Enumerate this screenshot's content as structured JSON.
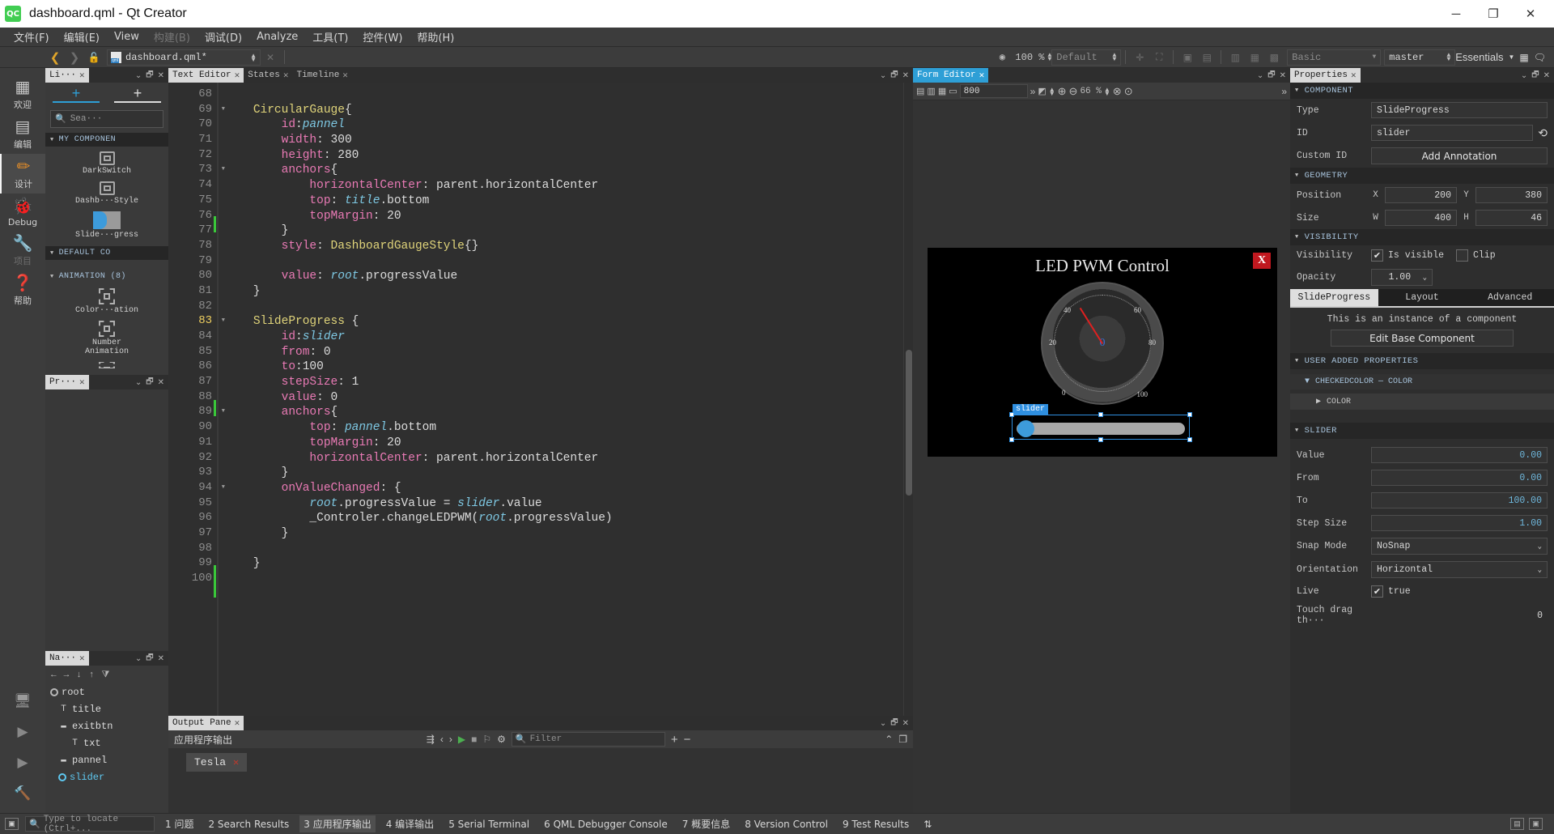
{
  "window": {
    "title": "dashboard.qml - Qt Creator",
    "logo": "qt-creator-logo",
    "minimize": "─",
    "maximize": "❐",
    "close": "✕"
  },
  "menu": [
    {
      "label": "文件(F)",
      "disabled": false
    },
    {
      "label": "编辑(E)",
      "disabled": false
    },
    {
      "label": "View",
      "disabled": false
    },
    {
      "label": "构建(B)",
      "disabled": true
    },
    {
      "label": "调试(D)",
      "disabled": false
    },
    {
      "label": "Analyze",
      "disabled": false
    },
    {
      "label": "工具(T)",
      "disabled": false
    },
    {
      "label": "控件(W)",
      "disabled": false
    },
    {
      "label": "帮助(H)",
      "disabled": false
    }
  ],
  "toolbar": {
    "back_icon": "❮",
    "forward_icon": "❯",
    "lock_icon": "🔓",
    "file_name": "dashboard.qml*",
    "file_icon": "qml-file-icon",
    "close_file_icon": "✕",
    "zoom_icon": "◉",
    "zoom_value": "100 %",
    "style_combo": "Default",
    "theme_combo": "Basic",
    "branch_combo": "master",
    "essentials_label": "Essentials"
  },
  "modes": [
    {
      "label": "欢迎",
      "icon": "grid-icon",
      "selected": false,
      "disabled": false
    },
    {
      "label": "编辑",
      "icon": "document-icon",
      "selected": false,
      "disabled": false
    },
    {
      "label": "设计",
      "icon": "pencil-icon",
      "selected": true,
      "disabled": false
    },
    {
      "label": "Debug",
      "icon": "bug-icon",
      "selected": false,
      "disabled": false
    },
    {
      "label": "项目",
      "icon": "wrench-icon",
      "selected": false,
      "disabled": true
    },
    {
      "label": "帮助",
      "icon": "question-icon",
      "selected": false,
      "disabled": false
    }
  ],
  "library": {
    "tab_label": "Li···",
    "tab_close": "✕",
    "add_component_icon": "+",
    "add_asset_icon": "+",
    "search_placeholder": "Sea···",
    "search_icon": "search-icon",
    "sections": [
      {
        "title": "MY COMPONEN",
        "items": [
          {
            "label": "DarkSwitch",
            "icon": "chip-icon"
          },
          {
            "label": "Dashb···Style",
            "icon": "chip-icon"
          },
          {
            "label": "Slide···gress",
            "icon": "slider-icon"
          }
        ]
      },
      {
        "title": "DEFAULT CO",
        "items": []
      },
      {
        "title": "ANIMATION (8)",
        "items": [
          {
            "label": "Color···ation",
            "icon": "animation-icon"
          },
          {
            "label": "Number\nAnimation",
            "icon": "animation-icon"
          }
        ]
      }
    ]
  },
  "properties_dock": {
    "tab_label": "Pr···",
    "tab_close": "✕"
  },
  "navigator": {
    "tab_label": "Na···",
    "tab_close": "✕",
    "toolbar_icons": [
      "←",
      "→",
      "↓",
      "↑",
      "filter-icon"
    ],
    "tree": [
      {
        "label": "root",
        "icon": "⬡",
        "indent": 0,
        "selected": false
      },
      {
        "label": "title",
        "icon": "T",
        "indent": 1,
        "selected": false
      },
      {
        "label": "exitbtn",
        "icon": "▭",
        "indent": 1,
        "selected": false
      },
      {
        "label": "txt",
        "icon": "T",
        "indent": 2,
        "selected": false
      },
      {
        "label": "pannel",
        "icon": "▭",
        "indent": 1,
        "selected": false
      },
      {
        "label": "slider",
        "icon": "⬡",
        "indent": 1,
        "selected": true
      }
    ]
  },
  "editor": {
    "tabs": [
      {
        "label": "Text Editor",
        "active": true
      },
      {
        "label": "States",
        "active": false
      },
      {
        "label": "Timeline",
        "active": false
      }
    ],
    "first_line": 68,
    "current_line": 83,
    "lines": [
      {
        "n": 68,
        "fold": false,
        "tokens": []
      },
      {
        "n": 69,
        "fold": true,
        "tokens": [
          {
            "t": "    ",
            "c": "p"
          },
          {
            "t": "CircularGauge",
            "c": "type"
          },
          {
            "t": "{",
            "c": "p"
          }
        ]
      },
      {
        "n": 70,
        "fold": false,
        "tokens": [
          {
            "t": "        ",
            "c": "p"
          },
          {
            "t": "id",
            "c": "prop"
          },
          {
            "t": ":",
            "c": "p"
          },
          {
            "t": "pannel",
            "c": "id"
          }
        ]
      },
      {
        "n": 71,
        "fold": false,
        "tokens": [
          {
            "t": "        ",
            "c": "p"
          },
          {
            "t": "width",
            "c": "prop"
          },
          {
            "t": ": 300",
            "c": "p"
          }
        ]
      },
      {
        "n": 72,
        "fold": false,
        "tokens": [
          {
            "t": "        ",
            "c": "p"
          },
          {
            "t": "height",
            "c": "prop"
          },
          {
            "t": ": 280",
            "c": "p"
          }
        ]
      },
      {
        "n": 73,
        "fold": true,
        "tokens": [
          {
            "t": "        ",
            "c": "p"
          },
          {
            "t": "anchors",
            "c": "prop"
          },
          {
            "t": "{",
            "c": "p"
          }
        ]
      },
      {
        "n": 74,
        "fold": false,
        "tokens": [
          {
            "t": "            ",
            "c": "p"
          },
          {
            "t": "horizontalCenter",
            "c": "prop"
          },
          {
            "t": ": parent.horizontalCenter",
            "c": "p"
          }
        ]
      },
      {
        "n": 75,
        "fold": false,
        "tokens": [
          {
            "t": "            ",
            "c": "p"
          },
          {
            "t": "top",
            "c": "prop"
          },
          {
            "t": ": ",
            "c": "p"
          },
          {
            "t": "title",
            "c": "id"
          },
          {
            "t": ".bottom",
            "c": "p"
          }
        ]
      },
      {
        "n": 76,
        "fold": false,
        "tokens": [
          {
            "t": "            ",
            "c": "p"
          },
          {
            "t": "topMargin",
            "c": "prop"
          },
          {
            "t": ": 20",
            "c": "p"
          }
        ]
      },
      {
        "n": 77,
        "fold": false,
        "tokens": [
          {
            "t": "        }",
            "c": "p"
          }
        ]
      },
      {
        "n": 78,
        "fold": false,
        "tokens": [
          {
            "t": "        ",
            "c": "p"
          },
          {
            "t": "style",
            "c": "prop"
          },
          {
            "t": ": ",
            "c": "p"
          },
          {
            "t": "DashboardGaugeStyle",
            "c": "type"
          },
          {
            "t": "{}",
            "c": "p"
          }
        ]
      },
      {
        "n": 79,
        "fold": false,
        "tokens": []
      },
      {
        "n": 80,
        "fold": false,
        "tokens": [
          {
            "t": "        ",
            "c": "p"
          },
          {
            "t": "value",
            "c": "prop"
          },
          {
            "t": ": ",
            "c": "p"
          },
          {
            "t": "root",
            "c": "id"
          },
          {
            "t": ".progressValue",
            "c": "p"
          }
        ]
      },
      {
        "n": 81,
        "fold": false,
        "tokens": [
          {
            "t": "    }",
            "c": "p"
          }
        ]
      },
      {
        "n": 82,
        "fold": false,
        "tokens": []
      },
      {
        "n": 83,
        "fold": true,
        "tokens": [
          {
            "t": "    ",
            "c": "p"
          },
          {
            "t": "SlideProgress",
            "c": "type"
          },
          {
            "t": " {",
            "c": "p"
          }
        ]
      },
      {
        "n": 84,
        "fold": false,
        "tokens": [
          {
            "t": "        ",
            "c": "p"
          },
          {
            "t": "id",
            "c": "prop"
          },
          {
            "t": ":",
            "c": "p"
          },
          {
            "t": "slider",
            "c": "id"
          }
        ]
      },
      {
        "n": 85,
        "fold": false,
        "tokens": [
          {
            "t": "        ",
            "c": "p"
          },
          {
            "t": "from",
            "c": "prop"
          },
          {
            "t": ": 0",
            "c": "p"
          }
        ]
      },
      {
        "n": 86,
        "fold": false,
        "tokens": [
          {
            "t": "        ",
            "c": "p"
          },
          {
            "t": "to",
            "c": "prop"
          },
          {
            "t": ":100",
            "c": "p"
          }
        ]
      },
      {
        "n": 87,
        "fold": false,
        "tokens": [
          {
            "t": "        ",
            "c": "p"
          },
          {
            "t": "stepSize",
            "c": "prop"
          },
          {
            "t": ": 1",
            "c": "p"
          }
        ]
      },
      {
        "n": 88,
        "fold": false,
        "tokens": [
          {
            "t": "        ",
            "c": "p"
          },
          {
            "t": "value",
            "c": "prop"
          },
          {
            "t": ": 0",
            "c": "p"
          }
        ]
      },
      {
        "n": 89,
        "fold": true,
        "tokens": [
          {
            "t": "        ",
            "c": "p"
          },
          {
            "t": "anchors",
            "c": "prop"
          },
          {
            "t": "{",
            "c": "p"
          }
        ]
      },
      {
        "n": 90,
        "fold": false,
        "tokens": [
          {
            "t": "            ",
            "c": "p"
          },
          {
            "t": "top",
            "c": "prop"
          },
          {
            "t": ": ",
            "c": "p"
          },
          {
            "t": "pannel",
            "c": "id"
          },
          {
            "t": ".bottom",
            "c": "p"
          }
        ]
      },
      {
        "n": 91,
        "fold": false,
        "tokens": [
          {
            "t": "            ",
            "c": "p"
          },
          {
            "t": "topMargin",
            "c": "prop"
          },
          {
            "t": ": 20",
            "c": "p"
          }
        ]
      },
      {
        "n": 92,
        "fold": false,
        "tokens": [
          {
            "t": "            ",
            "c": "p"
          },
          {
            "t": "horizontalCenter",
            "c": "prop"
          },
          {
            "t": ": parent.horizontalCenter",
            "c": "p"
          }
        ]
      },
      {
        "n": 93,
        "fold": false,
        "tokens": [
          {
            "t": "        }",
            "c": "p"
          }
        ]
      },
      {
        "n": 94,
        "fold": true,
        "tokens": [
          {
            "t": "        ",
            "c": "p"
          },
          {
            "t": "onValueChanged",
            "c": "prop"
          },
          {
            "t": ": {",
            "c": "p"
          }
        ]
      },
      {
        "n": 95,
        "fold": false,
        "tokens": [
          {
            "t": "            ",
            "c": "p"
          },
          {
            "t": "root",
            "c": "id"
          },
          {
            "t": ".progressValue = ",
            "c": "p"
          },
          {
            "t": "slider",
            "c": "id"
          },
          {
            "t": ".value",
            "c": "p"
          }
        ]
      },
      {
        "n": 96,
        "fold": false,
        "tokens": [
          {
            "t": "            _Controler.changeLEDPWM(",
            "c": "p"
          },
          {
            "t": "root",
            "c": "id"
          },
          {
            "t": ".progressValue)",
            "c": "p"
          }
        ]
      },
      {
        "n": 97,
        "fold": false,
        "tokens": [
          {
            "t": "        }",
            "c": "p"
          }
        ]
      },
      {
        "n": 98,
        "fold": false,
        "tokens": []
      },
      {
        "n": 99,
        "fold": false,
        "tokens": [
          {
            "t": "    }",
            "c": "p"
          }
        ]
      },
      {
        "n": 100,
        "fold": false,
        "tokens": []
      }
    ]
  },
  "form_editor": {
    "tab_label": "Form Editor",
    "tab_close": "✕",
    "width_value": "800",
    "zoom_value": "66 %",
    "zoom_in_icon": "⊕",
    "zoom_out_icon": "⊖",
    "device": {
      "title": "LED PWM Control",
      "exit_label": "X",
      "gauge": {
        "ticks": [
          "20",
          "40",
          "60",
          "80",
          "100",
          "0"
        ],
        "center_value": "0"
      },
      "selection_label": "slider"
    }
  },
  "properties": {
    "tab_label": "Properties",
    "tab_close": "✕",
    "sections": {
      "component": {
        "title": "COMPONENT",
        "type_label": "Type",
        "type_value": "SlideProgress",
        "id_label": "ID",
        "id_value": "slider",
        "reset_icon": "reset-icon",
        "custom_id_label": "Custom ID",
        "annotation_button": "Add Annotation"
      },
      "geometry": {
        "title": "GEOMETRY",
        "position_label": "Position",
        "x_label": "X",
        "x_value": "200",
        "y_label": "Y",
        "y_value": "380",
        "size_label": "Size",
        "w_label": "W",
        "w_value": "400",
        "h_label": "H",
        "h_value": "46"
      },
      "visibility": {
        "title": "VISIBILITY",
        "visibility_label": "Visibility",
        "is_visible_label": "Is visible",
        "is_visible_checked": "✔",
        "clip_label": "Clip",
        "clip_checked": "",
        "opacity_label": "Opacity",
        "opacity_value": "1.00"
      },
      "tabs": [
        {
          "label": "SlideProgress",
          "selected": true
        },
        {
          "label": "Layout",
          "selected": false
        },
        {
          "label": "Advanced",
          "selected": false
        }
      ],
      "instance_note": "This is an instance of a component",
      "edit_base_button": "Edit Base Component",
      "user_added": {
        "title": "USER ADDED PROPERTIES",
        "checkedcolor": "CHECKEDCOLOR — COLOR",
        "color": "COLOR"
      },
      "slider": {
        "title": "SLIDER",
        "rows": [
          {
            "label": "Value",
            "value": "0.00",
            "type": "num"
          },
          {
            "label": "From",
            "value": "0.00",
            "type": "num"
          },
          {
            "label": "To",
            "value": "100.00",
            "type": "num"
          },
          {
            "label": "Step Size",
            "value": "1.00",
            "type": "num"
          },
          {
            "label": "Snap Mode",
            "value": "NoSnap",
            "type": "combo"
          },
          {
            "label": "Orientation",
            "value": "Horizontal",
            "type": "combo"
          },
          {
            "label": "Live",
            "value": "true",
            "type": "check"
          },
          {
            "label": "Touch drag th···",
            "value": "0",
            "type": "num-plain"
          }
        ]
      }
    }
  },
  "output_pane": {
    "tab_label": "Output Pane",
    "tab_close": "✕",
    "title": "应用程序输出",
    "filter_placeholder": "Filter",
    "search_icon": "search-icon",
    "run_tab": "Tesla",
    "run_tab_close": "✕",
    "buttons": [
      "word-wrap-icon",
      "‹",
      "›",
      "▶",
      "■",
      "⚑",
      "⚙"
    ],
    "zoom_plus": "+",
    "zoom_minus": "−",
    "minimize_icon": "⌃",
    "maximize_icon": "❐"
  },
  "statusbar": {
    "locate_placeholder": "Type to locate (Ctrl+...",
    "locate_icon": "search-icon",
    "toggle_icon": "▣",
    "items": [
      {
        "label": "1 问题",
        "selected": false
      },
      {
        "label": "2 Search Results",
        "selected": false
      },
      {
        "label": "3 应用程序输出",
        "selected": true
      },
      {
        "label": "4 编译输出",
        "selected": false
      },
      {
        "label": "5 Serial Terminal",
        "selected": false
      },
      {
        "label": "6 QML Debugger Console",
        "selected": false
      },
      {
        "label": "7 概要信息",
        "selected": false
      },
      {
        "label": "8 Version Control",
        "selected": false
      },
      {
        "label": "9 Test Results",
        "selected": false
      }
    ],
    "more_icon": "⇅"
  },
  "colors": {
    "accent": "#2e9fd6",
    "selection": "#2f8fe0",
    "brand_green": "#41cd52",
    "error_red": "#c0181f",
    "slider_fill": "#3d9bdb",
    "needle_red": "#e02020"
  }
}
